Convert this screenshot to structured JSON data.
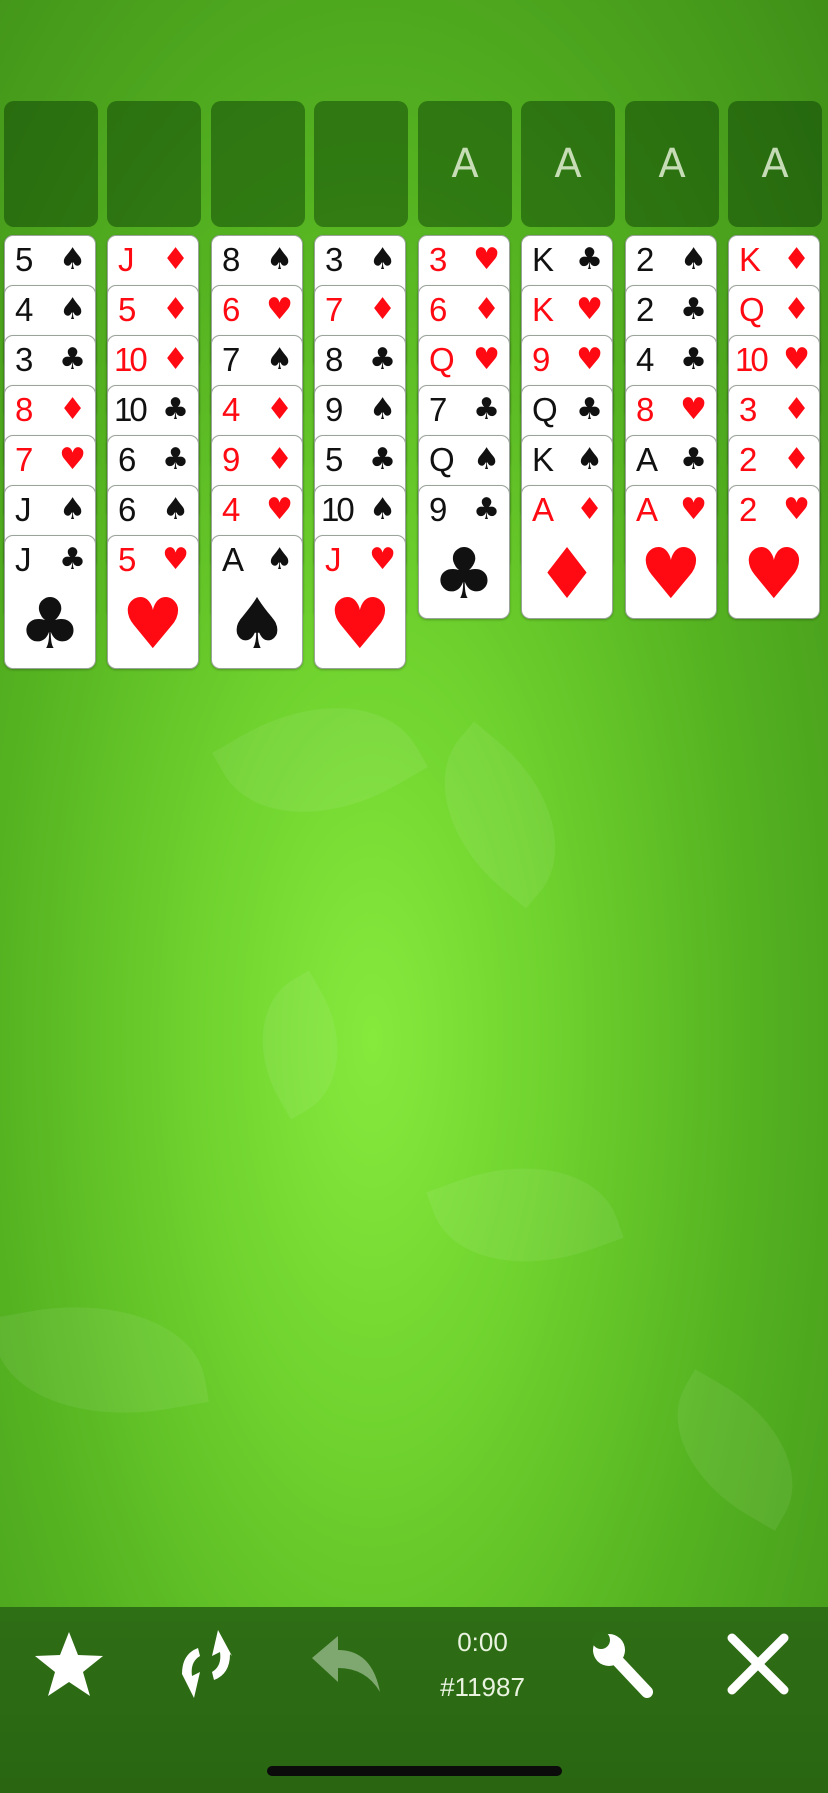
{
  "foundations": [
    "",
    "",
    "",
    "",
    "A",
    "A",
    "A",
    "A"
  ],
  "tableau": [
    [
      {
        "rank": "5",
        "suit": "♠",
        "color": "black"
      },
      {
        "rank": "4",
        "suit": "♠",
        "color": "black"
      },
      {
        "rank": "3",
        "suit": "♣",
        "color": "black"
      },
      {
        "rank": "8",
        "suit": "♦",
        "color": "red"
      },
      {
        "rank": "7",
        "suit": "♥",
        "color": "red"
      },
      {
        "rank": "J",
        "suit": "♠",
        "color": "black"
      },
      {
        "rank": "J",
        "suit": "♣",
        "color": "black"
      }
    ],
    [
      {
        "rank": "J",
        "suit": "♦",
        "color": "red"
      },
      {
        "rank": "5",
        "suit": "♦",
        "color": "red"
      },
      {
        "rank": "10",
        "suit": "♦",
        "color": "red"
      },
      {
        "rank": "10",
        "suit": "♣",
        "color": "black"
      },
      {
        "rank": "6",
        "suit": "♣",
        "color": "black"
      },
      {
        "rank": "6",
        "suit": "♠",
        "color": "black"
      },
      {
        "rank": "5",
        "suit": "♥",
        "color": "red"
      }
    ],
    [
      {
        "rank": "8",
        "suit": "♠",
        "color": "black"
      },
      {
        "rank": "6",
        "suit": "♥",
        "color": "red"
      },
      {
        "rank": "7",
        "suit": "♠",
        "color": "black"
      },
      {
        "rank": "4",
        "suit": "♦",
        "color": "red"
      },
      {
        "rank": "9",
        "suit": "♦",
        "color": "red"
      },
      {
        "rank": "4",
        "suit": "♥",
        "color": "red"
      },
      {
        "rank": "A",
        "suit": "♠",
        "color": "black"
      }
    ],
    [
      {
        "rank": "3",
        "suit": "♠",
        "color": "black"
      },
      {
        "rank": "7",
        "suit": "♦",
        "color": "red"
      },
      {
        "rank": "8",
        "suit": "♣",
        "color": "black"
      },
      {
        "rank": "9",
        "suit": "♠",
        "color": "black"
      },
      {
        "rank": "5",
        "suit": "♣",
        "color": "black"
      },
      {
        "rank": "10",
        "suit": "♠",
        "color": "black"
      },
      {
        "rank": "J",
        "suit": "♥",
        "color": "red"
      }
    ],
    [
      {
        "rank": "3",
        "suit": "♥",
        "color": "red"
      },
      {
        "rank": "6",
        "suit": "♦",
        "color": "red"
      },
      {
        "rank": "Q",
        "suit": "♥",
        "color": "red"
      },
      {
        "rank": "7",
        "suit": "♣",
        "color": "black"
      },
      {
        "rank": "Q",
        "suit": "♠",
        "color": "black"
      },
      {
        "rank": "9",
        "suit": "♣",
        "color": "black"
      }
    ],
    [
      {
        "rank": "K",
        "suit": "♣",
        "color": "black"
      },
      {
        "rank": "K",
        "suit": "♥",
        "color": "red"
      },
      {
        "rank": "9",
        "suit": "♥",
        "color": "red"
      },
      {
        "rank": "Q",
        "suit": "♣",
        "color": "black"
      },
      {
        "rank": "K",
        "suit": "♠",
        "color": "black"
      },
      {
        "rank": "A",
        "suit": "♦",
        "color": "red"
      }
    ],
    [
      {
        "rank": "2",
        "suit": "♠",
        "color": "black"
      },
      {
        "rank": "2",
        "suit": "♣",
        "color": "black"
      },
      {
        "rank": "4",
        "suit": "♣",
        "color": "black"
      },
      {
        "rank": "8",
        "suit": "♥",
        "color": "red"
      },
      {
        "rank": "A",
        "suit": "♣",
        "color": "black"
      },
      {
        "rank": "A",
        "suit": "♥",
        "color": "red"
      }
    ],
    [
      {
        "rank": "K",
        "suit": "♦",
        "color": "red"
      },
      {
        "rank": "Q",
        "suit": "♦",
        "color": "red"
      },
      {
        "rank": "10",
        "suit": "♥",
        "color": "red"
      },
      {
        "rank": "3",
        "suit": "♦",
        "color": "red"
      },
      {
        "rank": "2",
        "suit": "♦",
        "color": "red"
      },
      {
        "rank": "2",
        "suit": "♥",
        "color": "red"
      }
    ]
  ],
  "toolbar": {
    "timer": "0:00",
    "game_number": "#11987",
    "icons": [
      "star-icon",
      "replay-icon",
      "undo-icon",
      "wrench-icon",
      "close-icon"
    ]
  },
  "colors": {
    "red": "#ff0a12",
    "black": "#111111",
    "felt": "#6fd22e",
    "toolbar": "#2e6e15"
  }
}
